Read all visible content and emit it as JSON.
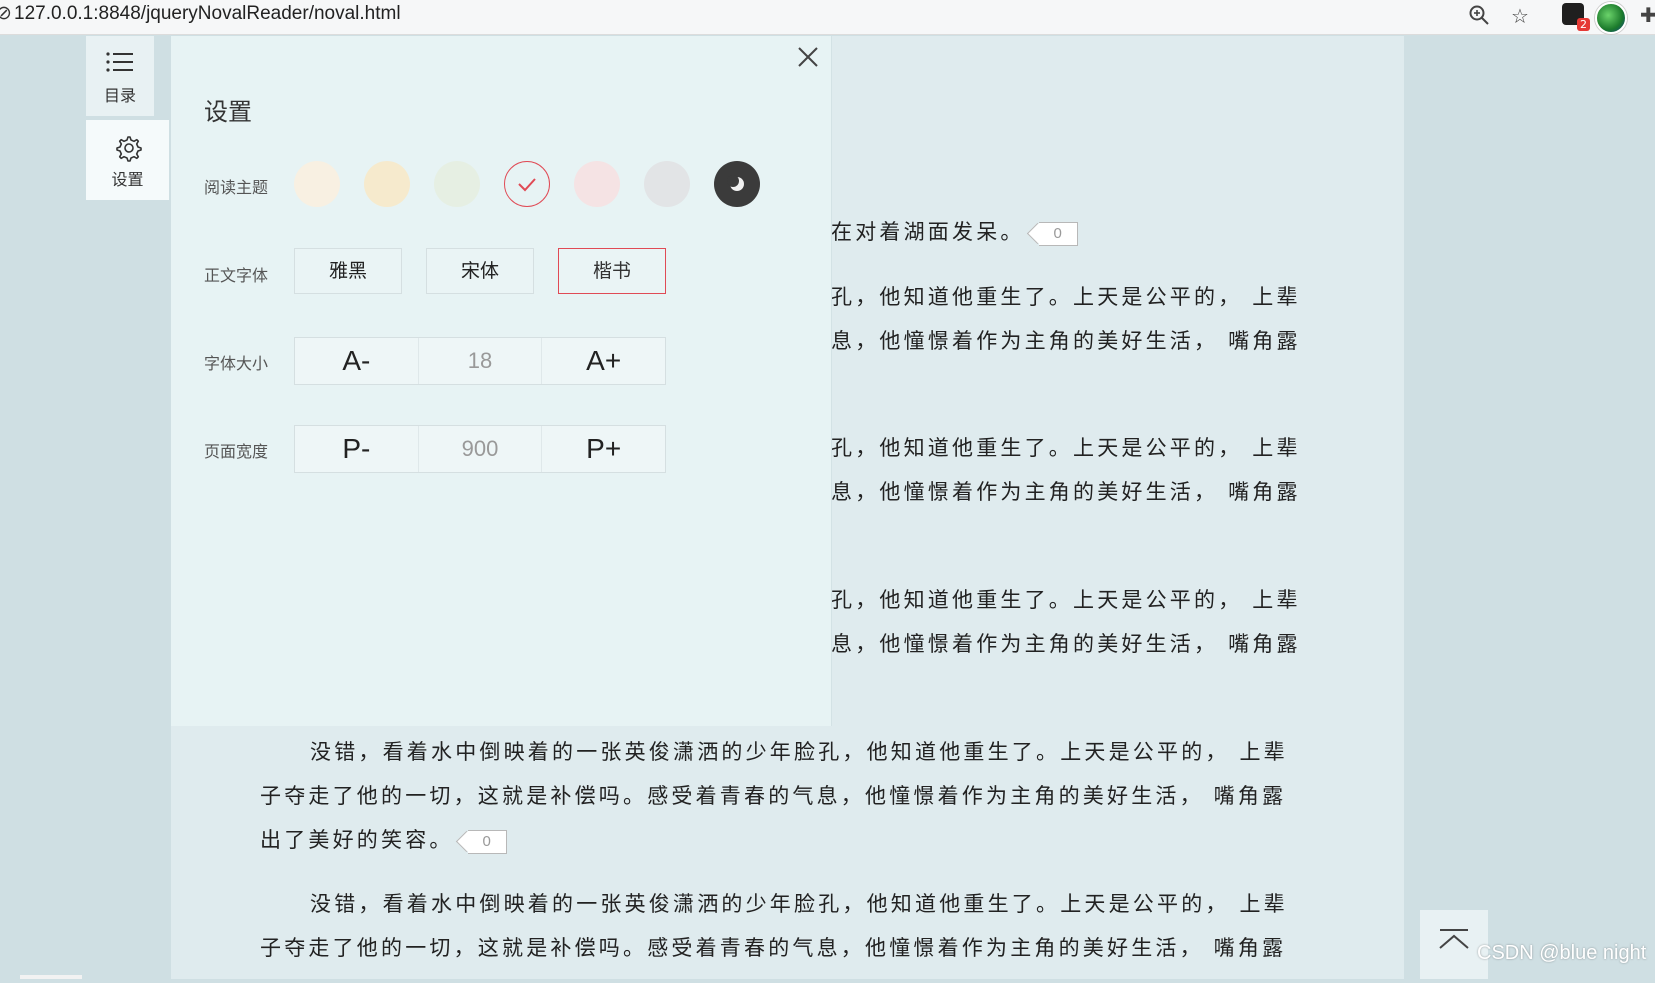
{
  "browser": {
    "url": "127.0.0.1:8848/jqueryNovalReader/noval.html",
    "extension_badge_count": "2"
  },
  "sidebar": {
    "items": [
      {
        "label": "目录",
        "icon": "list-icon"
      },
      {
        "label": "设置",
        "icon": "gear-icon"
      }
    ]
  },
  "settings": {
    "title": "设置",
    "theme_label": "阅读主题",
    "themes": [
      {
        "color": "#f8f0e2",
        "selected": false
      },
      {
        "color": "#f6eacd",
        "selected": false
      },
      {
        "color": "#e6efe3",
        "selected": false
      },
      {
        "color": "#e7f3f4",
        "selected": true
      },
      {
        "color": "#f5e3e4",
        "selected": false
      },
      {
        "color": "#e2e4e6",
        "selected": false
      },
      {
        "color": "#3b3b3b",
        "selected": false
      }
    ],
    "font_label": "正文字体",
    "fonts": [
      {
        "label": "雅黑",
        "selected": false
      },
      {
        "label": "宋体",
        "selected": false
      },
      {
        "label": "楷书",
        "selected": true
      }
    ],
    "size_label": "字体大小",
    "size_dec": "A-",
    "size_value": "18",
    "size_inc": "A+",
    "width_label": "页面宽度",
    "width_dec": "P-",
    "width_value": "900",
    "width_inc": "P+"
  },
  "content": {
    "p1_tail": "在对着湖面发呆。",
    "p1_count": "0",
    "partial_line_a": "孔，他知道他重生了。上天是公平的， 上辈",
    "partial_line_b": "息，他憧憬着作为主角的美好生活， 嘴角露",
    "full_line_1": "没错，看着水中倒映着的一张英俊潇洒的少年脸孔，他知道他重生了。上天是公平的， 上辈",
    "full_line_2": "子夺走了他的一切，这就是补偿吗。感受着青春的气息，他憧憬着作为主角的美好生活， 嘴角露",
    "full_line_3": "出了美好的笑容。",
    "p_count": "0"
  },
  "watermark": "CSDN @blue night"
}
